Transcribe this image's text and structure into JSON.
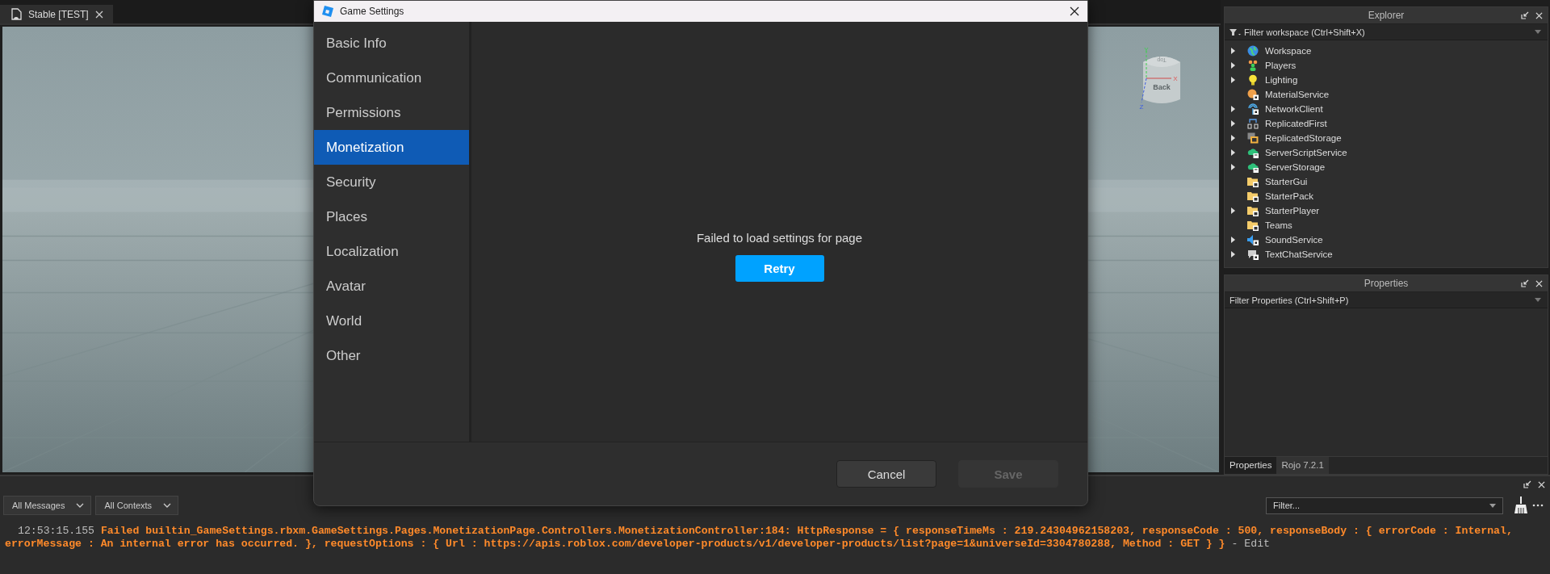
{
  "document_tab": {
    "label": "Stable [TEST]",
    "selected": true
  },
  "view_cube": {
    "top_face": "Top",
    "front_face": "Back",
    "axes": [
      "Y",
      "X",
      "Z"
    ]
  },
  "dialog": {
    "title": "Game Settings",
    "nav": [
      {
        "label": "Basic Info",
        "selected": false
      },
      {
        "label": "Communication",
        "selected": false
      },
      {
        "label": "Permissions",
        "selected": false
      },
      {
        "label": "Monetization",
        "selected": true
      },
      {
        "label": "Security",
        "selected": false
      },
      {
        "label": "Places",
        "selected": false
      },
      {
        "label": "Localization",
        "selected": false
      },
      {
        "label": "Avatar",
        "selected": false
      },
      {
        "label": "World",
        "selected": false
      },
      {
        "label": "Other",
        "selected": false
      }
    ],
    "message": "Failed to load settings for page",
    "retry_button": "Retry",
    "cancel_button": "Cancel",
    "save_button": {
      "label": "Save",
      "disabled": true
    }
  },
  "explorer": {
    "title": "Explorer",
    "filter_placeholder": "Filter workspace (Ctrl+Shift+X)",
    "items": [
      {
        "label": "Workspace",
        "kind": "globe",
        "expandable": true
      },
      {
        "label": "Players",
        "kind": "people",
        "expandable": true
      },
      {
        "label": "Lighting",
        "kind": "bulb",
        "expandable": true
      },
      {
        "label": "MaterialService",
        "kind": "palette",
        "expandable": false
      },
      {
        "label": "NetworkClient",
        "kind": "antenna",
        "expandable": true
      },
      {
        "label": "ReplicatedFirst",
        "kind": "branch",
        "expandable": true
      },
      {
        "label": "ReplicatedStorage",
        "kind": "storage",
        "expandable": true
      },
      {
        "label": "ServerScriptService",
        "kind": "cloud",
        "expandable": true
      },
      {
        "label": "ServerStorage",
        "kind": "cloud",
        "expandable": true
      },
      {
        "label": "StarterGui",
        "kind": "folder",
        "expandable": false
      },
      {
        "label": "StarterPack",
        "kind": "folder",
        "expandable": false
      },
      {
        "label": "StarterPlayer",
        "kind": "folder",
        "expandable": true
      },
      {
        "label": "Teams",
        "kind": "folder",
        "expandable": false
      },
      {
        "label": "SoundService",
        "kind": "speaker",
        "expandable": true
      },
      {
        "label": "TextChatService",
        "kind": "chat",
        "expandable": true
      }
    ]
  },
  "properties": {
    "title": "Properties",
    "filter_placeholder": "Filter Properties (Ctrl+Shift+P)",
    "tabs": [
      {
        "label": "Properties",
        "selected": true
      },
      {
        "label": "Rojo 7.2.1",
        "selected": false
      }
    ]
  },
  "output": {
    "message_filter": "All Messages",
    "context_filter": "All Contexts",
    "filter_placeholder": "Filter...",
    "entries": [
      {
        "time": "12:53:15.155",
        "text": "Failed builtin_GameSettings.rbxm.GameSettings.Pages.MonetizationPage.Controllers.MonetizationController:184: HttpResponse = { responseTimeMs : 219.24304962158203, responseCode : 500, responseBody : { errorCode : Internal, errorMessage : An internal error has occurred. }, requestOptions : { Url : https://apis.roblox.com/developer-products/v1/developer-products/list?page=1&universeId=3304780288, Method : GET } }",
        "separator": "-",
        "source": "Edit"
      }
    ]
  }
}
